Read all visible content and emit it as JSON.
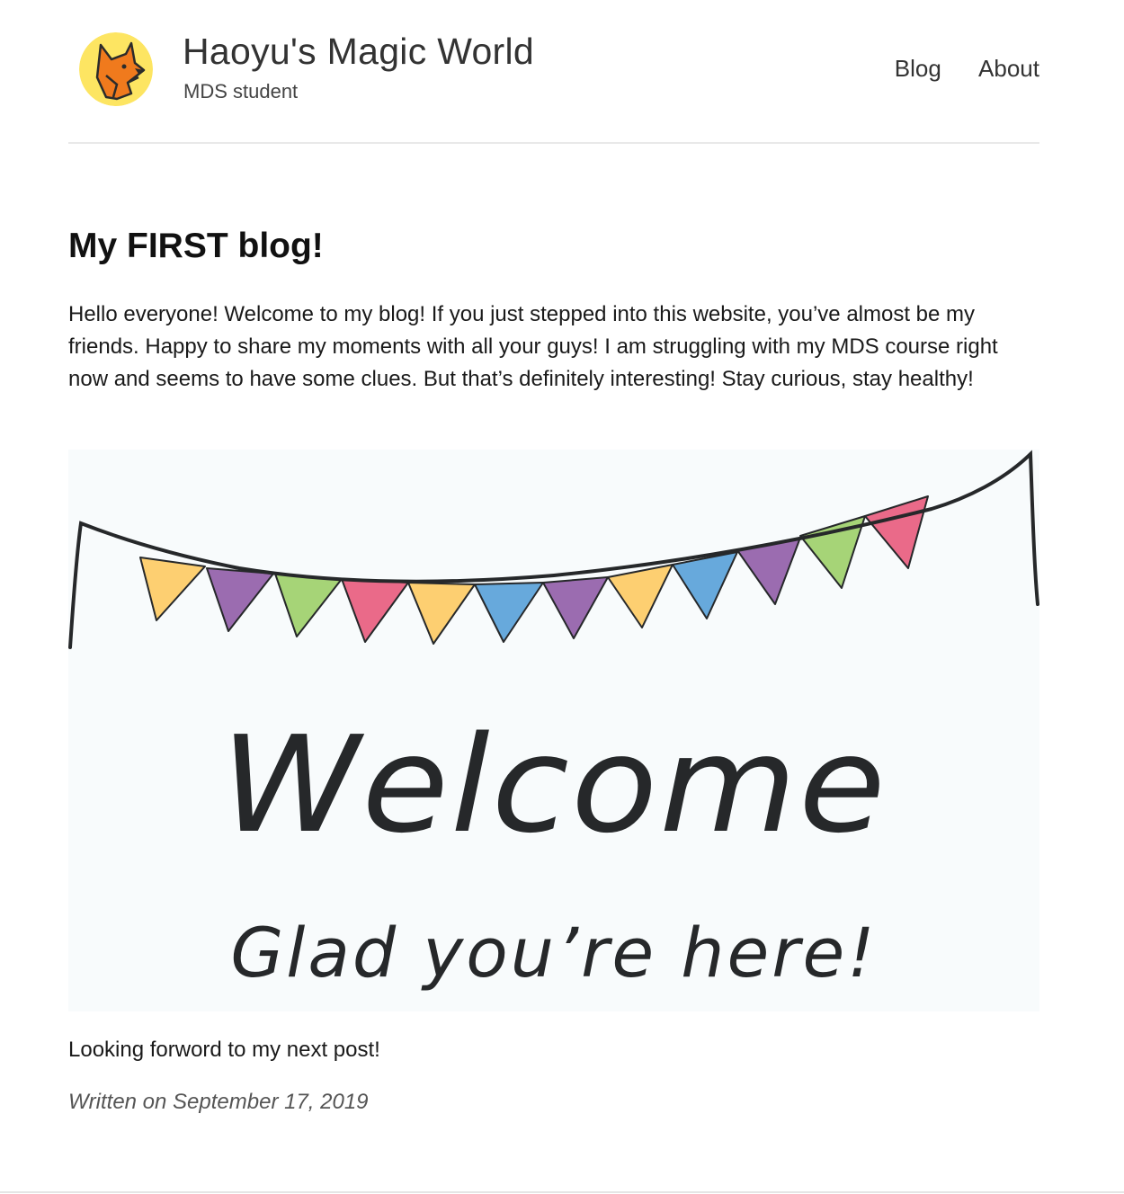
{
  "header": {
    "site_title": "Haoyu's Magic World",
    "site_description": "MDS student",
    "avatar_icon": "fox-avatar-icon",
    "avatar_colors": {
      "background": "#fde562",
      "fox": "#f07a1d",
      "outline": "#2b2b2b"
    }
  },
  "nav": {
    "items": [
      {
        "label": "Blog"
      },
      {
        "label": "About"
      }
    ]
  },
  "post": {
    "title": "My FIRST blog!",
    "intro": "Hello everyone! Welcome to my blog! If you just stepped into this website, you’ve almost be my friends. Happy to share my moments with all your guys! I am struggling with my MDS course right now and seems to have some clues. But that’s definitely interesting! Stay curious, stay healthy!",
    "image": {
      "headline": "Welcome",
      "subline": "Glad you’re here!",
      "flag_colors": [
        "#fdcf71",
        "#9b6cb0",
        "#a6d477",
        "#ea6a89",
        "#fdcf71",
        "#67a9dc",
        "#9b6cb0",
        "#fdcf71",
        "#67a9dc",
        "#9b6cb0",
        "#a6d477",
        "#ea6a89"
      ]
    },
    "outro": "Looking forword to my next post!",
    "date": "Written on September 17, 2019"
  }
}
